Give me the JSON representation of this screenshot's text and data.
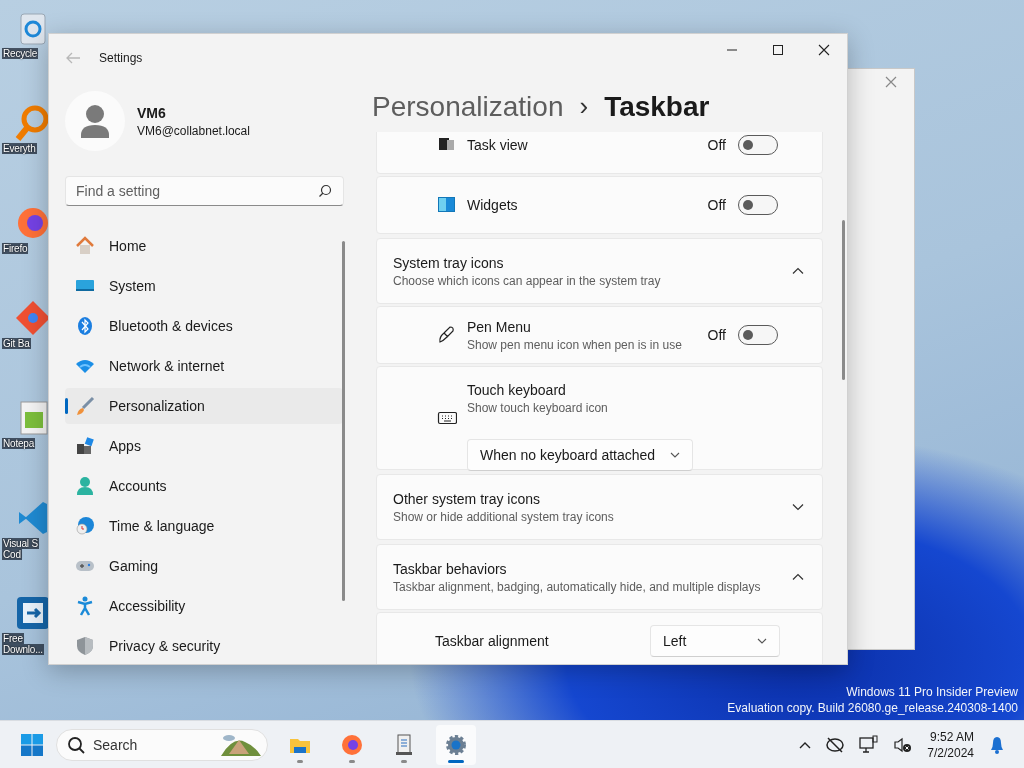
{
  "desktop_icons": [
    {
      "lines": [
        "Recycle"
      ]
    },
    {
      "lines": [
        "Everyth"
      ]
    },
    {
      "lines": [
        "Firefo"
      ]
    },
    {
      "lines": [
        "Git Ba"
      ]
    },
    {
      "lines": [
        "Notepa"
      ]
    },
    {
      "lines": [
        "Visual S",
        "Cod"
      ]
    },
    {
      "lines": [
        "Free",
        "Downlo..."
      ]
    }
  ],
  "settings": {
    "title": "Settings",
    "user": {
      "name": "VM6",
      "email": "VM6@collabnet.local"
    },
    "search": {
      "placeholder": "Find a setting"
    },
    "nav": [
      {
        "label": "Home",
        "selected": false
      },
      {
        "label": "System",
        "selected": false
      },
      {
        "label": "Bluetooth & devices",
        "selected": false
      },
      {
        "label": "Network & internet",
        "selected": false
      },
      {
        "label": "Personalization",
        "selected": true
      },
      {
        "label": "Apps",
        "selected": false
      },
      {
        "label": "Accounts",
        "selected": false
      },
      {
        "label": "Time & language",
        "selected": false
      },
      {
        "label": "Gaming",
        "selected": false
      },
      {
        "label": "Accessibility",
        "selected": false
      },
      {
        "label": "Privacy & security",
        "selected": false
      }
    ],
    "breadcrumb": {
      "parent": "Personalization",
      "separator": "›",
      "current": "Taskbar"
    },
    "cards": [
      {
        "rows": [
          {
            "kind": "toggle",
            "label": "Task view",
            "state_label": "Off",
            "on": false
          },
          {
            "kind": "toggle",
            "label": "Widgets",
            "state_label": "Off",
            "on": false
          }
        ]
      },
      {
        "rows": [
          {
            "kind": "header",
            "label": "System tray icons",
            "subtitle": "Choose which icons can appear in the system tray",
            "expanded": true
          },
          {
            "kind": "toggle",
            "label": "Pen Menu",
            "subtitle": "Show pen menu icon when pen is in use",
            "state_label": "Off",
            "on": false
          },
          {
            "kind": "select",
            "label": "Touch keyboard",
            "subtitle": "Show touch keyboard icon",
            "value": "When no keyboard attached"
          }
        ]
      },
      {
        "rows": [
          {
            "kind": "header",
            "label": "Other system tray icons",
            "subtitle": "Show or hide additional system tray icons",
            "expanded": false
          }
        ]
      },
      {
        "rows": [
          {
            "kind": "header",
            "label": "Taskbar behaviors",
            "subtitle": "Taskbar alignment, badging, automatically hide, and multiple displays",
            "expanded": true
          },
          {
            "kind": "inline_select",
            "label": "Taskbar alignment",
            "value": "Left"
          }
        ]
      }
    ]
  },
  "watermark": {
    "line1": "Windows 11 Pro Insider Preview",
    "line2": "Evaluation copy. Build 26080.ge_release.240308-1400"
  },
  "taskbar": {
    "search_placeholder": "Search",
    "apps": [
      {
        "selected": false
      },
      {
        "selected": false
      },
      {
        "selected": false
      },
      {
        "selected": true
      }
    ],
    "time": "9:52 AM",
    "date": "7/2/2024"
  }
}
